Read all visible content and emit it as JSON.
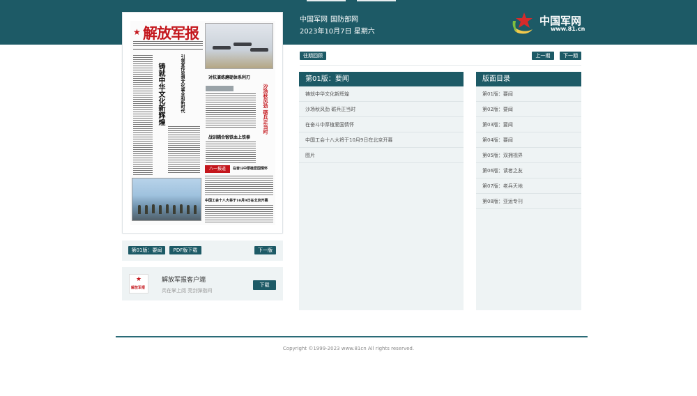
{
  "header": {
    "site_links": [
      "中国军网",
      "国防部网"
    ],
    "date": "2023年10月7日 星期六",
    "logo_title": "中国军网",
    "logo_url": "www.81.cn",
    "brand_color": "#1d5a66"
  },
  "newspaper": {
    "masthead": "解放军报",
    "headline_main": "铸就中华文化新辉煌",
    "headline_sub": "引领宣传思想文化事业和新时代",
    "headline_right": "沙场秋风劲 砺兵正当时",
    "headline_mid1": "对抗演练磨砺体系利刃",
    "headline_mid2": "战训耦合锻铁血上铁拳",
    "red_tag": "八一报道",
    "headline_bottom1": "在奋斗中厚植爱国情怀",
    "headline_bottom2": "中国工会十八大将于10月9日在北京开幕"
  },
  "page_bar": {
    "current_label": "第01版：要闻",
    "pdf_label": "PDF版下载",
    "next_label": "下一版"
  },
  "client": {
    "title": "解放军报客户端",
    "subtitle": "兵在掌上阅 亮剑弹指间",
    "download_label": "下载",
    "logo_text": "解放军报"
  },
  "nav": {
    "archive_label": "往期回顾",
    "prev_issue_label": "上一期",
    "next_issue_label": "下一期"
  },
  "articles": {
    "heading": "第01版：要闻",
    "items": [
      "铸就中华文化新辉煌",
      "沙场秋风劲 砺兵正当时",
      "在奋斗中厚植爱国情怀",
      "中国工会十八大将于10月9日在北京开幕",
      "图片"
    ]
  },
  "directory": {
    "heading": "版面目录",
    "items": [
      "第01版：要闻",
      "第02版：要闻",
      "第03版：要闻",
      "第04版：要闻",
      "第05版：双拥视界",
      "第06版：读者之友",
      "第07版：老兵天地",
      "第08版：亚运专刊"
    ]
  },
  "footer": {
    "copyright": "Copyright ©1999-2023 www.81cn All rights reserved."
  }
}
